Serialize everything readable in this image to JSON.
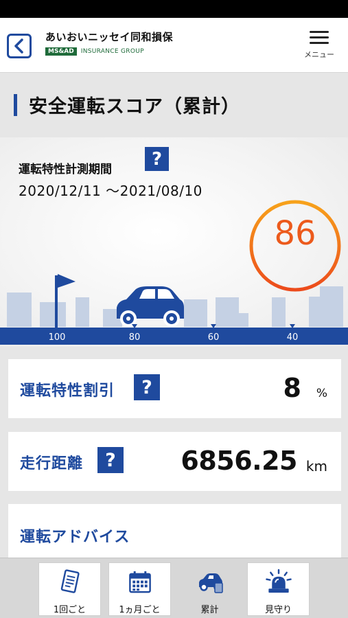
{
  "header": {
    "brand_name": "あいおいニッセイ同和損保",
    "brand_badge": "MS&AD",
    "brand_group": "INSURANCE GROUP",
    "menu_label": "メニュー"
  },
  "page_title": "安全運転スコア（累計）",
  "score_panel": {
    "period_label": "運転特性計測期間",
    "period_value": "2020/12/11 ～2021/08/10",
    "score": "86",
    "score_scale": [
      "100",
      "80",
      "60",
      "40"
    ],
    "colors": {
      "ring_start": "#f7a21b",
      "ring_end": "#ec4b1c",
      "road": "#1f4a9e"
    }
  },
  "help_mark": "?",
  "cards": {
    "discount": {
      "label": "運転特性割引",
      "value": "8",
      "unit": "%"
    },
    "distance": {
      "label": "走行距離",
      "value": "6856.25",
      "unit": "km"
    },
    "advice": {
      "label": "運転アドバイス"
    }
  },
  "tabbar": {
    "tabs": [
      {
        "label": "1回ごと",
        "icon": "document-icon"
      },
      {
        "label": "1ヵ月ごと",
        "icon": "calendar-icon"
      },
      {
        "label": "累計",
        "icon": "car-stack-icon"
      },
      {
        "label": "見守り",
        "icon": "alert-light-icon"
      }
    ]
  }
}
